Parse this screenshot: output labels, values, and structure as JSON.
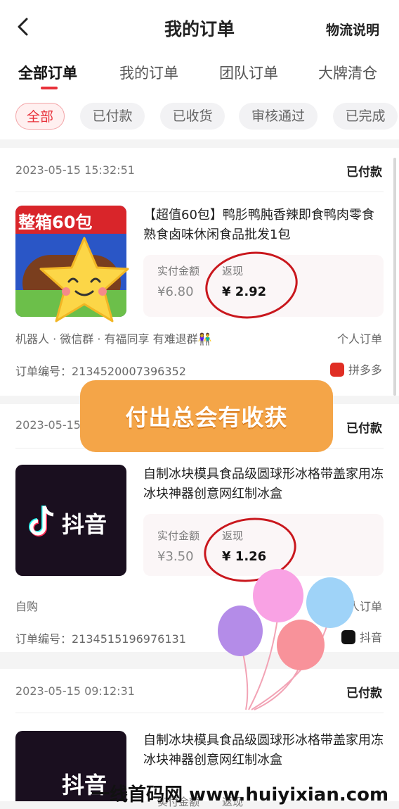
{
  "header": {
    "title": "我的订单",
    "help": "物流说明",
    "back_icon": "chevron-left-icon"
  },
  "tabs": [
    {
      "label": "全部订单",
      "active": true
    },
    {
      "label": "我的订单"
    },
    {
      "label": "团队订单"
    },
    {
      "label": "大牌清仓"
    }
  ],
  "filters": [
    {
      "label": "全部",
      "active": true
    },
    {
      "label": "已付款"
    },
    {
      "label": "已收货"
    },
    {
      "label": "审核通过"
    },
    {
      "label": "已完成"
    }
  ],
  "orders": [
    {
      "date": "2023-05-15 15:32:51",
      "status": "已付款",
      "title": "【超值60包】鸭肜鸭肫香辣即食鸭肉零食熟食卤味休闲食品批发1包",
      "thumb_text": "整箱60包",
      "paid_label": "实付金额",
      "paid": "¥6.80",
      "cashback_label": "返现",
      "cashback": "¥ 2.92",
      "source": "机器人 · 微信群 · 有福同享 有难退群👫",
      "order_type": "个人订单",
      "order_no": "订单编号：2134520007396352",
      "platform": "拼多多"
    },
    {
      "date": "2023-05-15",
      "status": "已付款",
      "title": "自制冰块模具食品级圆球形冰格带盖家用冻冰块神器创意网红制冰盒",
      "thumb_text": "抖音",
      "paid_label": "实付金额",
      "paid": "¥3.50",
      "cashback_label": "返现",
      "cashback": "¥ 1.26",
      "source": "自购",
      "order_type": "个人订单",
      "order_no": "订单编号：2134515196976131",
      "platform": "抖音"
    },
    {
      "date": "2023-05-15 09:12:31",
      "status": "已付款",
      "title": "自制冰块模具食品级圆球形冰格带盖家用冻冰块神器创意网红制冰盒",
      "thumb_text": "抖音",
      "paid_label": "实付金额",
      "cashback_label": "返现"
    }
  ],
  "banner": "付出总会有收获",
  "watermark": "一线首码网 www.huiyixian.com",
  "colors": {
    "accent": "#e8313a",
    "banner": "#f4a548",
    "ring": "#c9171d",
    "douyin": "#1a0f1f"
  }
}
